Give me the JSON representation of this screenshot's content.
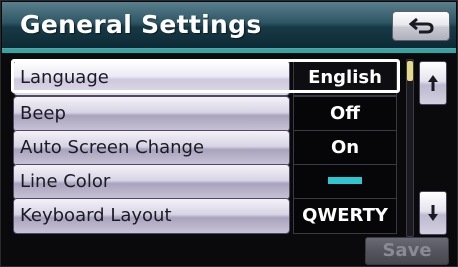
{
  "header": {
    "title": "General Settings",
    "back_icon": "back-arrow-icon"
  },
  "settings": [
    {
      "label": "Language",
      "value": "English",
      "selected": true
    },
    {
      "label": "Beep",
      "value": "Off"
    },
    {
      "label": "Auto Screen Change",
      "value": "On"
    },
    {
      "label": "Line Color",
      "value": "",
      "swatch_color": "#2ec7cf"
    },
    {
      "label": "Keyboard Layout",
      "value": "QWERTY"
    }
  ],
  "scroll": {
    "up_icon": "scroll-up-icon",
    "down_icon": "scroll-down-icon"
  },
  "footer": {
    "save_label": "Save"
  },
  "colors": {
    "accent_teal": "#2ea8a4",
    "title_bar": "#173946"
  }
}
